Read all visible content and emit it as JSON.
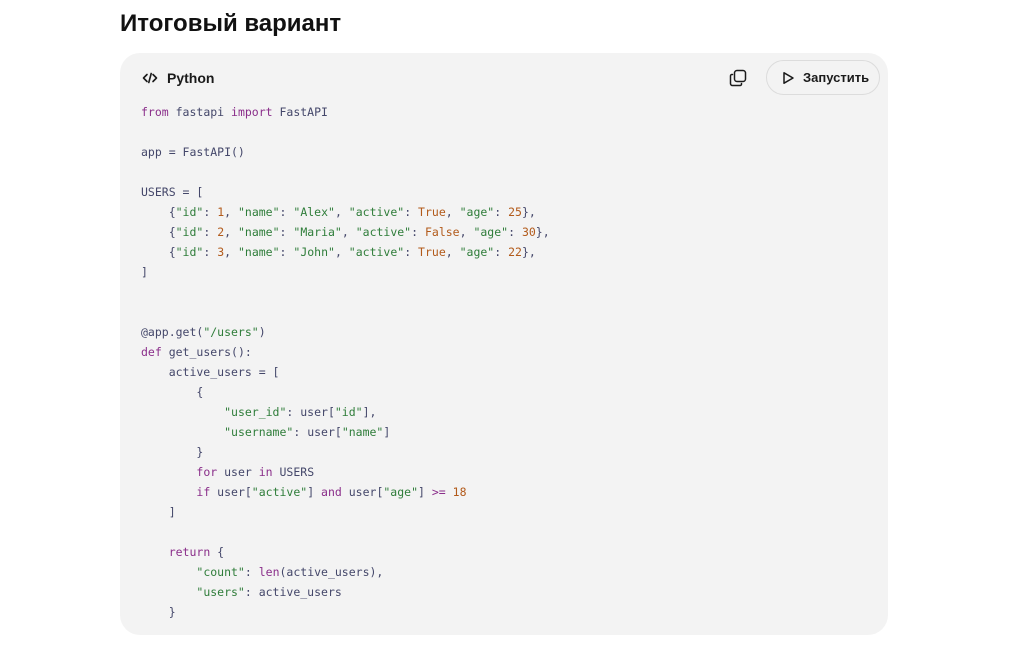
{
  "section": {
    "title": "Итоговый вариант"
  },
  "code_block": {
    "language": "Python",
    "language_icon": "code-icon",
    "copy_icon": "copy-icon",
    "run_label": "Запустить",
    "run_icon": "play-icon",
    "lines": [
      [
        {
          "t": "kw",
          "v": "from"
        },
        {
          "t": "plain",
          "v": " fastapi "
        },
        {
          "t": "kw",
          "v": "import"
        },
        {
          "t": "plain",
          "v": " FastAPI"
        }
      ],
      [],
      [
        {
          "t": "plain",
          "v": "app = FastAPI()"
        }
      ],
      [],
      [
        {
          "t": "plain",
          "v": "USERS = ["
        }
      ],
      [
        {
          "t": "plain",
          "v": "    {"
        },
        {
          "t": "str",
          "v": "\"id\""
        },
        {
          "t": "plain",
          "v": ": "
        },
        {
          "t": "num",
          "v": "1"
        },
        {
          "t": "plain",
          "v": ", "
        },
        {
          "t": "str",
          "v": "\"name\""
        },
        {
          "t": "plain",
          "v": ": "
        },
        {
          "t": "str",
          "v": "\"Alex\""
        },
        {
          "t": "plain",
          "v": ", "
        },
        {
          "t": "str",
          "v": "\"active\""
        },
        {
          "t": "plain",
          "v": ": "
        },
        {
          "t": "num",
          "v": "True"
        },
        {
          "t": "plain",
          "v": ", "
        },
        {
          "t": "str",
          "v": "\"age\""
        },
        {
          "t": "plain",
          "v": ": "
        },
        {
          "t": "num",
          "v": "25"
        },
        {
          "t": "plain",
          "v": "},"
        }
      ],
      [
        {
          "t": "plain",
          "v": "    {"
        },
        {
          "t": "str",
          "v": "\"id\""
        },
        {
          "t": "plain",
          "v": ": "
        },
        {
          "t": "num",
          "v": "2"
        },
        {
          "t": "plain",
          "v": ", "
        },
        {
          "t": "str",
          "v": "\"name\""
        },
        {
          "t": "plain",
          "v": ": "
        },
        {
          "t": "str",
          "v": "\"Maria\""
        },
        {
          "t": "plain",
          "v": ", "
        },
        {
          "t": "str",
          "v": "\"active\""
        },
        {
          "t": "plain",
          "v": ": "
        },
        {
          "t": "num",
          "v": "False"
        },
        {
          "t": "plain",
          "v": ", "
        },
        {
          "t": "str",
          "v": "\"age\""
        },
        {
          "t": "plain",
          "v": ": "
        },
        {
          "t": "num",
          "v": "30"
        },
        {
          "t": "plain",
          "v": "},"
        }
      ],
      [
        {
          "t": "plain",
          "v": "    {"
        },
        {
          "t": "str",
          "v": "\"id\""
        },
        {
          "t": "plain",
          "v": ": "
        },
        {
          "t": "num",
          "v": "3"
        },
        {
          "t": "plain",
          "v": ", "
        },
        {
          "t": "str",
          "v": "\"name\""
        },
        {
          "t": "plain",
          "v": ": "
        },
        {
          "t": "str",
          "v": "\"John\""
        },
        {
          "t": "plain",
          "v": ", "
        },
        {
          "t": "str",
          "v": "\"active\""
        },
        {
          "t": "plain",
          "v": ": "
        },
        {
          "t": "num",
          "v": "True"
        },
        {
          "t": "plain",
          "v": ", "
        },
        {
          "t": "str",
          "v": "\"age\""
        },
        {
          "t": "plain",
          "v": ": "
        },
        {
          "t": "num",
          "v": "22"
        },
        {
          "t": "plain",
          "v": "},"
        }
      ],
      [
        {
          "t": "plain",
          "v": "]"
        }
      ],
      [],
      [],
      [
        {
          "t": "plain",
          "v": "@app.get("
        },
        {
          "t": "str",
          "v": "\"/users\""
        },
        {
          "t": "plain",
          "v": ")"
        }
      ],
      [
        {
          "t": "kw",
          "v": "def"
        },
        {
          "t": "plain",
          "v": " get_users():"
        }
      ],
      [
        {
          "t": "plain",
          "v": "    active_users = ["
        }
      ],
      [
        {
          "t": "plain",
          "v": "        {"
        }
      ],
      [
        {
          "t": "plain",
          "v": "            "
        },
        {
          "t": "str",
          "v": "\"user_id\""
        },
        {
          "t": "plain",
          "v": ": user["
        },
        {
          "t": "str",
          "v": "\"id\""
        },
        {
          "t": "plain",
          "v": "],"
        }
      ],
      [
        {
          "t": "plain",
          "v": "            "
        },
        {
          "t": "str",
          "v": "\"username\""
        },
        {
          "t": "plain",
          "v": ": user["
        },
        {
          "t": "str",
          "v": "\"name\""
        },
        {
          "t": "plain",
          "v": "]"
        }
      ],
      [
        {
          "t": "plain",
          "v": "        }"
        }
      ],
      [
        {
          "t": "plain",
          "v": "        "
        },
        {
          "t": "kw",
          "v": "for"
        },
        {
          "t": "plain",
          "v": " user "
        },
        {
          "t": "kw",
          "v": "in"
        },
        {
          "t": "plain",
          "v": " USERS"
        }
      ],
      [
        {
          "t": "plain",
          "v": "        "
        },
        {
          "t": "kw",
          "v": "if"
        },
        {
          "t": "plain",
          "v": " user["
        },
        {
          "t": "str",
          "v": "\"active\""
        },
        {
          "t": "plain",
          "v": "] "
        },
        {
          "t": "kw",
          "v": "and"
        },
        {
          "t": "plain",
          "v": " user["
        },
        {
          "t": "str",
          "v": "\"age\""
        },
        {
          "t": "plain",
          "v": "] "
        },
        {
          "t": "kw",
          "v": ">="
        },
        {
          "t": "plain",
          "v": " "
        },
        {
          "t": "num",
          "v": "18"
        }
      ],
      [
        {
          "t": "plain",
          "v": "    ]"
        }
      ],
      [],
      [
        {
          "t": "plain",
          "v": "    "
        },
        {
          "t": "kw",
          "v": "return"
        },
        {
          "t": "plain",
          "v": " {"
        }
      ],
      [
        {
          "t": "plain",
          "v": "        "
        },
        {
          "t": "str",
          "v": "\"count\""
        },
        {
          "t": "plain",
          "v": ": "
        },
        {
          "t": "kw",
          "v": "len"
        },
        {
          "t": "plain",
          "v": "(active_users),"
        }
      ],
      [
        {
          "t": "plain",
          "v": "        "
        },
        {
          "t": "str",
          "v": "\"users\""
        },
        {
          "t": "plain",
          "v": ": active_users"
        }
      ],
      [
        {
          "t": "plain",
          "v": "    }"
        }
      ]
    ]
  },
  "colors": {
    "card_background": "#f3f3f3",
    "keyword": "#8a2e8a",
    "string": "#2f7d3a",
    "number": "#b25a1a",
    "identifier": "#44476a"
  }
}
